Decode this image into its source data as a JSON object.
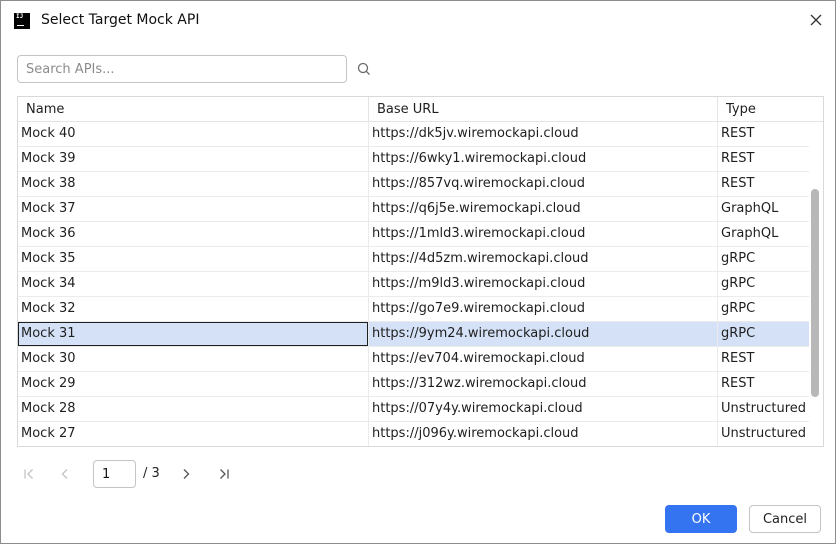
{
  "window": {
    "title": "Select Target Mock API",
    "icon": "jetbrains-app-icon",
    "icon_text": "IJ"
  },
  "search": {
    "placeholder": "Search APIs...",
    "value": ""
  },
  "table": {
    "columns": [
      "Name",
      "Base URL",
      "Type"
    ],
    "rows": [
      {
        "name": "Mock 40",
        "url": "https://dk5jv.wiremockapi.cloud",
        "type": "REST"
      },
      {
        "name": "Mock 39",
        "url": "https://6wky1.wiremockapi.cloud",
        "type": "REST"
      },
      {
        "name": "Mock 38",
        "url": "https://857vq.wiremockapi.cloud",
        "type": "REST"
      },
      {
        "name": "Mock 37",
        "url": "https://q6j5e.wiremockapi.cloud",
        "type": "GraphQL"
      },
      {
        "name": "Mock 36",
        "url": "https://1mld3.wiremockapi.cloud",
        "type": "GraphQL"
      },
      {
        "name": "Mock 35",
        "url": "https://4d5zm.wiremockapi.cloud",
        "type": "gRPC"
      },
      {
        "name": "Mock 34",
        "url": "https://m9ld3.wiremockapi.cloud",
        "type": "gRPC"
      },
      {
        "name": "Mock 32",
        "url": "https://go7e9.wiremockapi.cloud",
        "type": "gRPC"
      },
      {
        "name": "Mock 31",
        "url": "https://9ym24.wiremockapi.cloud",
        "type": "gRPC"
      },
      {
        "name": "Mock 30",
        "url": "https://ev704.wiremockapi.cloud",
        "type": "REST"
      },
      {
        "name": "Mock 29",
        "url": "https://312wz.wiremockapi.cloud",
        "type": "REST"
      },
      {
        "name": "Mock 28",
        "url": "https://07y4y.wiremockapi.cloud",
        "type": "Unstructured"
      },
      {
        "name": "Mock 27",
        "url": "https://j096y.wiremockapi.cloud",
        "type": "Unstructured"
      }
    ],
    "selected_row": "Mock 31"
  },
  "pagination": {
    "current_page": "1",
    "total_label": "/ 3"
  },
  "buttons": {
    "ok": "OK",
    "cancel": "Cancel"
  },
  "colors": {
    "accent": "#3574f0",
    "selection": "#d5e1f7"
  }
}
